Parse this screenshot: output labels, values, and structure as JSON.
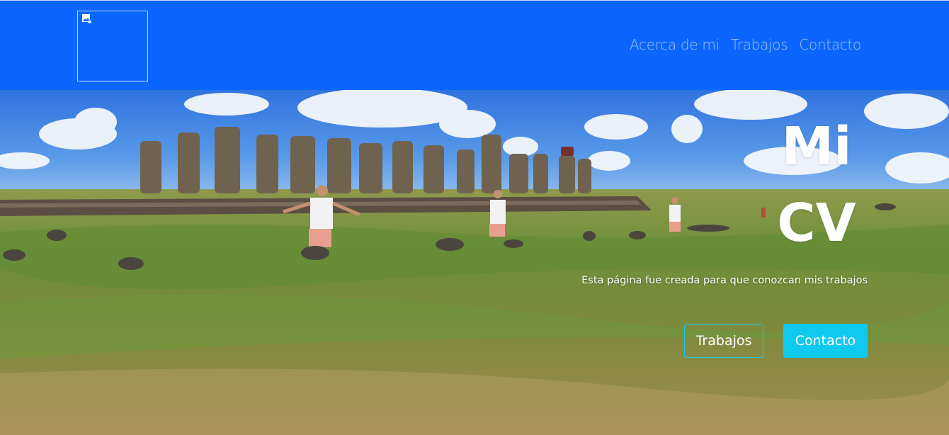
{
  "nav": {
    "logo_alt": "",
    "links": [
      "Acerca de mi",
      "Trabajos",
      "Contacto"
    ]
  },
  "hero": {
    "title_line1": "Mi",
    "title_line2": "CV",
    "subtitle": "Esta página fue creada para que conozcan mis trabajos",
    "buttons": {
      "trabajos": "Trabajos",
      "contacto": "Contacto"
    },
    "background": "panorama-moai-statues-grass-field"
  },
  "colors": {
    "navbar": "#0a66ff",
    "nav_link": "#9ec3f2",
    "accent": "#10c9ef"
  }
}
